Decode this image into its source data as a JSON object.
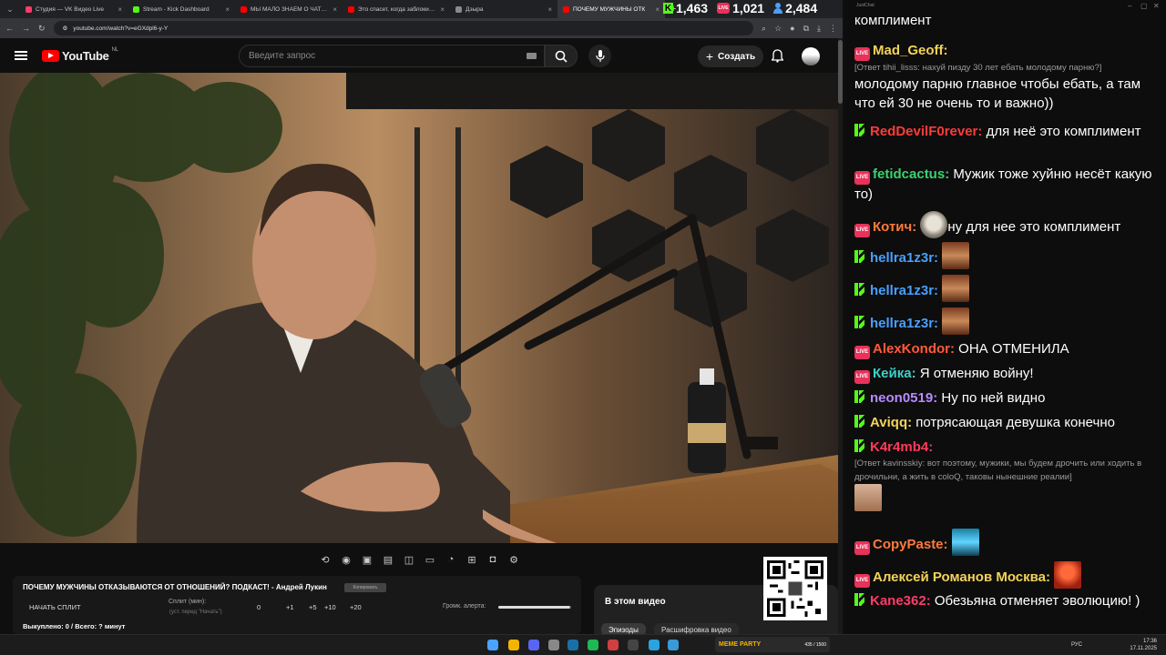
{
  "browser": {
    "tabs": [
      {
        "title": "Студия — VK Видео Live",
        "color": "#ff3b6b",
        "active": false
      },
      {
        "title": "Stream - Kick Dashboard",
        "color": "#53fc18",
        "active": false
      },
      {
        "title": "МЫ МАЛО ЗНАЕМ О ЧАТРУЛЕ",
        "color": "#ff0000",
        "active": false
      },
      {
        "title": "Это спасет, когда заблокируют",
        "color": "#ff0000",
        "active": false
      },
      {
        "title": "Дзыра",
        "color": "#8a8a8a",
        "active": false
      },
      {
        "title": "ПОЧЕМУ МУЖЧИНЫ ОТК",
        "color": "#ff0000",
        "active": true
      }
    ],
    "url": "youtube.com/watch?v=eGXdpl6-y-Y"
  },
  "stats": {
    "kick_viewers": "1,463",
    "vk_viewers": "1,021",
    "total_viewers": "2,484"
  },
  "youtube": {
    "logo_text": "YouTube",
    "region": "NL",
    "search_placeholder": "Введите запрос",
    "create_label": "Создать"
  },
  "split_panel": {
    "video_title": "ПОЧЕМУ МУЖЧИНЫ ОТКАЗЫВАЮТСЯ ОТ ОТНОШЕНИЙ? ПОДКАСТ! - Андрей Лукин",
    "copy_label": "Копировать",
    "start_split": "НАЧАТЬ СПЛИТ",
    "split_label": "Сплит (мин):",
    "split_hint": "(уст. перед \"Начать\")",
    "split_value": "0",
    "increments": [
      "+1",
      "+5",
      "+10",
      "+20"
    ],
    "alert_volume_label": "Громк. алерта:",
    "alert_volume": 0.98,
    "bought_status": "Выкуплено: 0 / Всего: ? минут"
  },
  "episodes": {
    "title": "В этом видео",
    "chips": [
      "Эпизоды",
      "Расшифровка видео"
    ]
  },
  "chat": {
    "app_title": "JustChat",
    "messages": [
      {
        "platform": "vk",
        "user": "",
        "text": "комплимент",
        "color": "#fff"
      },
      {
        "platform": "vk",
        "user": "Mad_Geoff:",
        "color": "#f3d35a",
        "reply": "[Ответ tihii_lisss: нахуй пизду 30 лет ебать молодому парню?]",
        "text": "молодому парню главное чтобы ебать, а там что ей 30 не очень то и важно))"
      },
      {
        "platform": "kick",
        "user": "RedDevilF0rever:",
        "color": "#ff3b3b",
        "text": "для неё это комплимент"
      },
      {
        "platform": "vk",
        "user": "fetidcactus:",
        "color": "#3bd16f",
        "text": "Мужик тоже хуйню несёт какую то)"
      },
      {
        "platform": "vk",
        "user": "Котич:",
        "color": "#ff7a3b",
        "text": "ну для нее это комплимент",
        "emote": "sloth"
      },
      {
        "platform": "kick",
        "user": "hellra1z3r:",
        "color": "#4a9fff",
        "emote": "face"
      },
      {
        "platform": "kick",
        "user": "hellra1z3r:",
        "color": "#4a9fff",
        "emote": "face"
      },
      {
        "platform": "kick",
        "user": "hellra1z3r:",
        "color": "#4a9fff",
        "emote": "face"
      },
      {
        "platform": "vk",
        "user": "AlexKondor:",
        "color": "#ff5a3b",
        "text": "ОНА ОТМЕНИЛА"
      },
      {
        "platform": "vk",
        "user": "Кейка:",
        "color": "#3bd1c8",
        "text": "Я отменяю войну!"
      },
      {
        "platform": "kick",
        "user": "neon0519:",
        "color": "#b98aff",
        "text": "Ну по ней видно"
      },
      {
        "platform": "kick",
        "user": "Aviqq:",
        "color": "#f3d35a",
        "text": "потрясающая девушка конечно"
      },
      {
        "platform": "kick",
        "user": "K4r4mb4:",
        "color": "#ff3b5a",
        "reply": "[Ответ kavinsskiy: вот поэтому, мужики, мы будем дрочить или ходить в дрочильни, а жить в coloQ, таковы нынешние реалии]",
        "emote": "face2"
      },
      {
        "platform": "vk",
        "user": "CopyPaste:",
        "color": "#ff7a3b",
        "emote": "cyan"
      },
      {
        "platform": "vk",
        "user": "Алексей Романов Москва:",
        "color": "#f3d35a",
        "emote": "red"
      },
      {
        "platform": "kick",
        "user": "Kane362:",
        "color": "#ff3b6b",
        "text": "Обезьяна отменяет эволюцию! )"
      }
    ]
  },
  "taskbar": {
    "lang": "РУС",
    "time": "17:36",
    "date": "17.11.2025",
    "widget": "MEME PARTY",
    "widget_count": "435 / 1500"
  },
  "colors": {
    "accent_red": "#ff0000",
    "kick_green": "#53fc18",
    "vk_live": "#e8325a",
    "bg": "#0f0f0f"
  }
}
